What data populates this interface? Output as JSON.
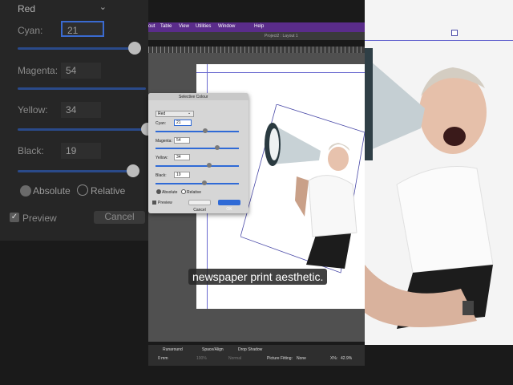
{
  "left_panel": {
    "dropdown": "Red",
    "rows": [
      {
        "label": "Cyan:",
        "value": "21"
      },
      {
        "label": "Magenta:",
        "value": "54"
      },
      {
        "label": "Yellow:",
        "value": "34"
      },
      {
        "label": "Black:",
        "value": "19"
      }
    ],
    "absolute": "Absolute",
    "relative": "Relative",
    "preview": "Preview",
    "cancel": "Cancel"
  },
  "menu": {
    "items": [
      "out",
      "Table",
      "View",
      "Utilities",
      "Window",
      "Help"
    ]
  },
  "title": "Project2 : Layout 1",
  "dialog": {
    "title": "Selective Colour",
    "dropdown": "Red",
    "rows": [
      {
        "label": "Cyan:",
        "value": "21",
        "level": 0.21
      },
      {
        "label": "Magenta:",
        "value": "54",
        "level": 0.54
      },
      {
        "label": "Yellow:",
        "value": "34",
        "level": 0.34
      },
      {
        "label": "Black:",
        "value": "19",
        "level": 0.19
      }
    ],
    "absolute": "Absolute",
    "relative": "Relative",
    "preview": "Preview",
    "cancel": "Cancel",
    "ok": "OK"
  },
  "caption": "newspaper print aesthetic.",
  "bottom": {
    "tabs": [
      "Runaround",
      "Space/Align",
      "Drop Shadow"
    ],
    "field1": "0 mm",
    "field2": "100%",
    "field3": "Normal",
    "fitting_label": "Picture Fitting:",
    "fitting_value": "None",
    "x_label": "X%:",
    "x_value": "42.9%"
  }
}
